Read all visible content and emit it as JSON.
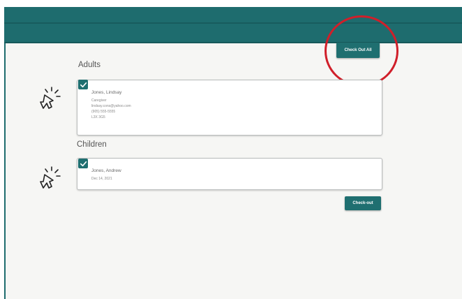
{
  "header": {
    "check_out_all_label": "Check Out All"
  },
  "sections": {
    "adults": {
      "title": "Adults",
      "person": {
        "name": "Jones, Lindsay",
        "role": "Caregiver",
        "email": "lindsay.cons@yahoo.com",
        "phone": "(905) 555-5555",
        "postal": "L3X 3G5"
      }
    },
    "children": {
      "title": "Children",
      "person": {
        "name": "Jones, Andrew",
        "dob": "Dec 14, 2021"
      }
    }
  },
  "actions": {
    "check_out_label": "Check-out"
  },
  "icons": {
    "checkbox": "check-icon",
    "cursor": "pointer-click-icon"
  },
  "colors": {
    "primary": "#1f6f70",
    "appbar": "#1e6c6e",
    "highlight": "#d01f2a",
    "background": "#f6f6f4"
  }
}
